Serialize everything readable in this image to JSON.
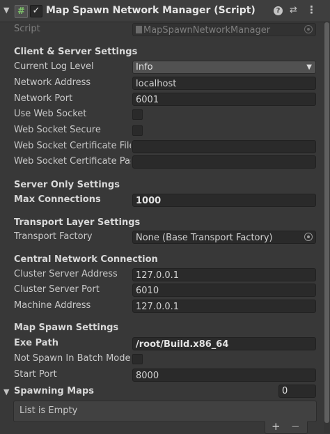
{
  "header": {
    "title": "Map Spawn Network Manager (Script)",
    "script_icon_glyph": "#",
    "checkbox_glyph": "✓",
    "fold_glyph": "▼",
    "help_glyph": "?",
    "preset_glyph": "⇄",
    "more_glyph": "⋮"
  },
  "script": {
    "label": "Script",
    "value": "MapSpawnNetworkManager"
  },
  "client_server": {
    "header": "Client & Server Settings",
    "log_level_label": "Current Log Level",
    "log_level_value": "Info",
    "caret_glyph": "▼",
    "address_label": "Network Address",
    "address_value": "localhost",
    "port_label": "Network Port",
    "port_value": "6001",
    "use_ws_label": "Use Web Socket",
    "use_ws": false,
    "ws_secure_label": "Web Socket Secure",
    "ws_secure": false,
    "ws_cert_file_label": "Web Socket Certificate File Path",
    "ws_cert_file_value": "",
    "ws_cert_pass_label": "Web Socket Certificate Password",
    "ws_cert_pass_value": ""
  },
  "server_only": {
    "header": "Server Only Settings",
    "max_conn_label": "Max Connections",
    "max_conn_value": "1000"
  },
  "transport": {
    "header": "Transport Layer Settings",
    "factory_label": "Transport Factory",
    "factory_value": "None (Base Transport Factory)"
  },
  "central": {
    "header": "Central Network Connection",
    "cluster_addr_label": "Cluster Server Address",
    "cluster_addr_value": "127.0.0.1",
    "cluster_port_label": "Cluster Server Port",
    "cluster_port_value": "6010",
    "machine_addr_label": "Machine Address",
    "machine_addr_value": "127.0.0.1"
  },
  "map_spawn": {
    "header": "Map Spawn Settings",
    "exe_path_label": "Exe Path",
    "exe_path_value": "/root/Build.x86_64",
    "not_spawn_label": "Not Spawn In Batch Mode",
    "not_spawn": false,
    "start_port_label": "Start Port",
    "start_port_value": "8000"
  },
  "spawning_maps": {
    "label": "Spawning Maps",
    "size": "0",
    "empty_text": "List is Empty",
    "add_glyph": "+",
    "remove_glyph": "−"
  }
}
